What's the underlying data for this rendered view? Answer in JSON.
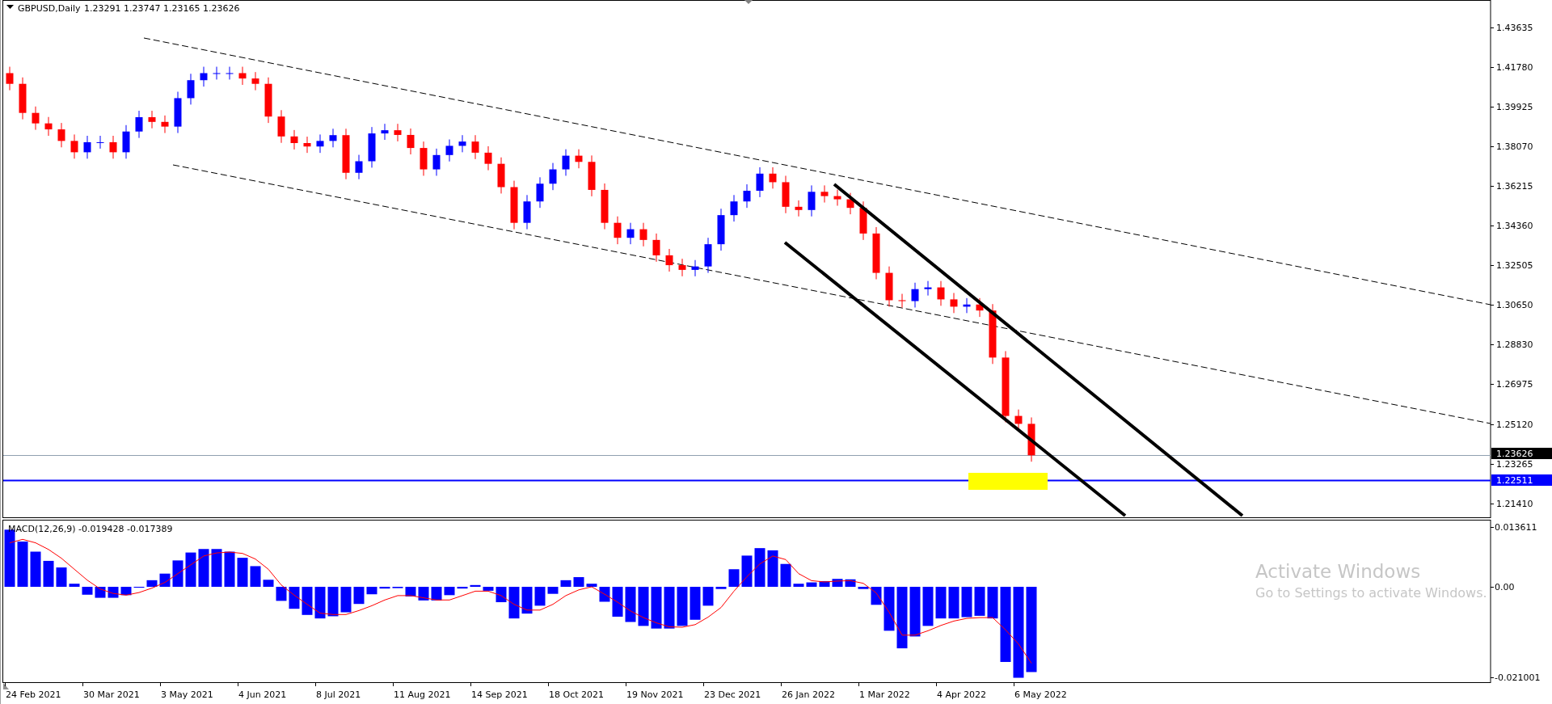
{
  "header": {
    "symbol": "GBPUSD,Daily",
    "ohlc": "1.23291 1.23747 1.23165 1.23626"
  },
  "price_axis": [
    "1.43635",
    "1.41780",
    "1.39925",
    "1.38070",
    "1.36215",
    "1.34360",
    "1.32505",
    "1.30650",
    "1.28830",
    "1.26975",
    "1.25120",
    "1.23265",
    "1.21410"
  ],
  "price_tags": [
    {
      "kind": "bid",
      "text": "1.23626"
    },
    {
      "kind": "level",
      "text": "1.22511"
    }
  ],
  "macd": {
    "label": "MACD(12,26,9) -0.019428 -0.017389",
    "axis": [
      "0.013611",
      "0.00",
      "-0.021001"
    ]
  },
  "date_axis": [
    "24 Feb 2021",
    "30 Mar 2021",
    "3 May 2021",
    "4 Jun 2021",
    "8 Jul 2021",
    "11 Aug 2021",
    "14 Sep 2021",
    "18 Oct 2021",
    "19 Nov 2021",
    "23 Dec 2021",
    "26 Jan 2022",
    "1 Mar 2022",
    "4 Apr 2022",
    "6 May 2022"
  ],
  "watermark": {
    "title": "Activate Windows",
    "hint": "Go to Settings to activate Windows."
  }
}
